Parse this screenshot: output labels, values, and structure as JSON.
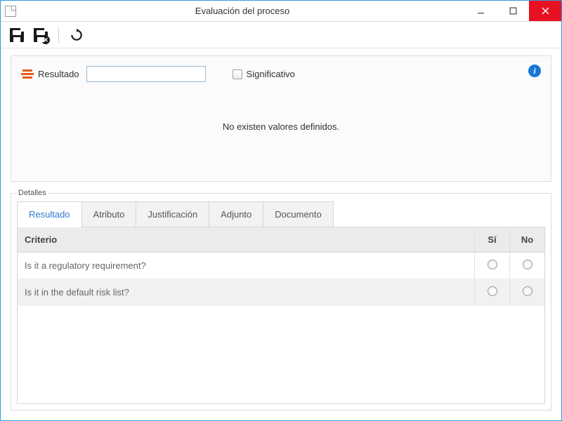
{
  "window": {
    "title": "Evaluación del proceso"
  },
  "header": {
    "result_label": "Resultado",
    "result_value": "",
    "significant_label": "Significativo",
    "empty_message": "No existen valores definidos."
  },
  "details": {
    "legend": "Detalles",
    "tabs": [
      "Resultado",
      "Atributo",
      "Justificación",
      "Adjunto",
      "Documento"
    ],
    "columns": {
      "criteria": "Criterio",
      "yes": "Sí",
      "no": "No"
    },
    "rows": [
      {
        "criteria": "Is it a regulatory requirement?"
      },
      {
        "criteria": "Is it in the default risk list?"
      }
    ]
  }
}
